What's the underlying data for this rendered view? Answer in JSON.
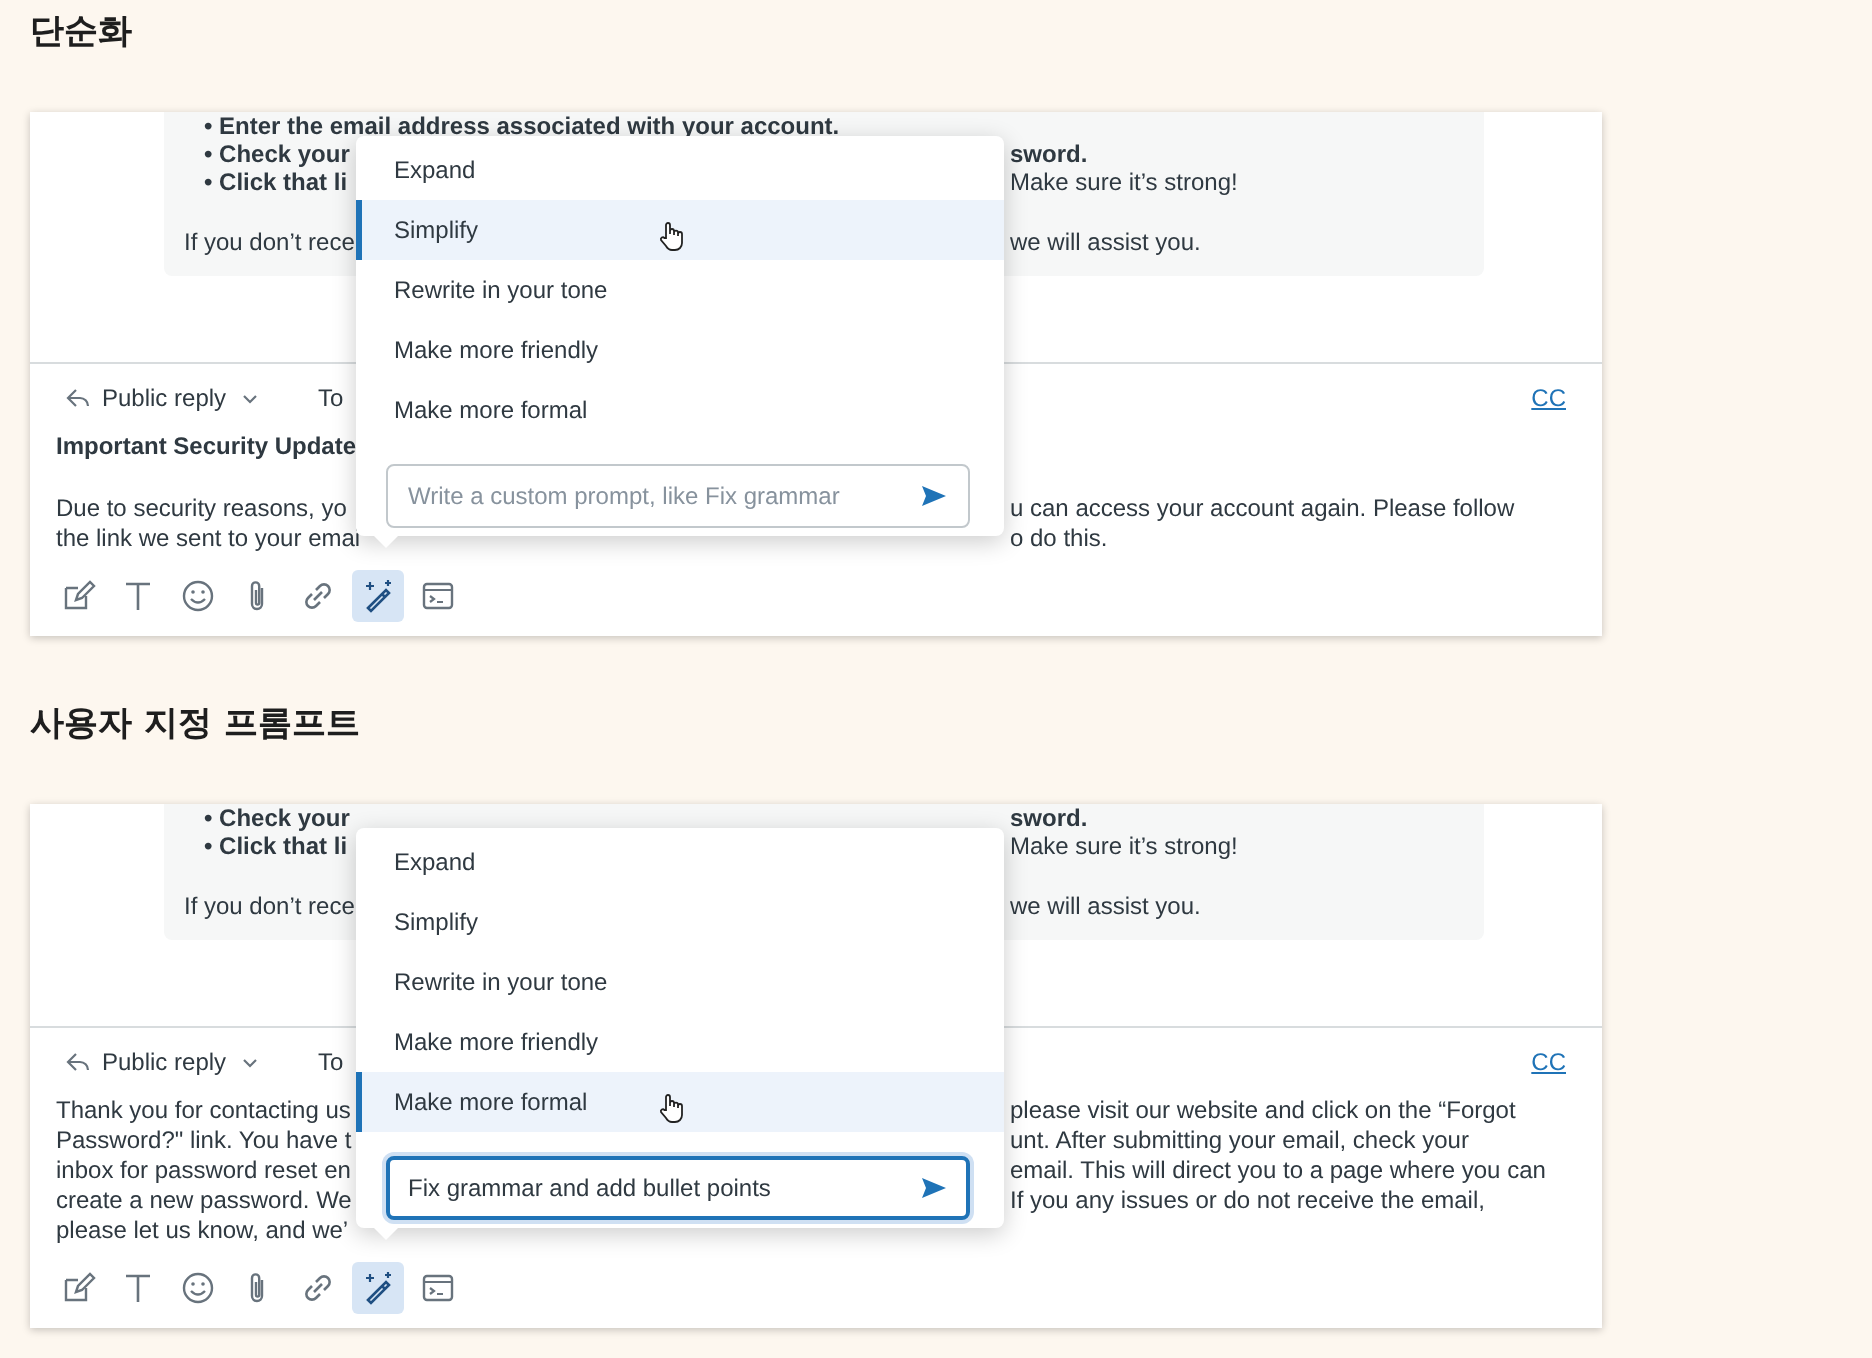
{
  "sections": [
    {
      "heading": "단순화",
      "quote_lines": [
        {
          "kind": "bullet",
          "left": {
            "text": "• Enter the email address associated with your account.",
            "bold": true
          }
        },
        {
          "kind": "bullet",
          "left": {
            "text": "• Check your",
            "bold": true
          },
          "right": {
            "text": "sword.",
            "bold": true
          }
        },
        {
          "kind": "bullet",
          "left": {
            "text": "• Click that li",
            "bold": true
          },
          "right": {
            "text": "Make sure it’s strong!",
            "bold": false
          }
        },
        {
          "kind": "paragraph",
          "left": {
            "text": "If you don’t rece",
            "bold": false
          },
          "right": {
            "text": "we will assist you.",
            "bold": false
          }
        }
      ],
      "reply": {
        "mode": "Public reply",
        "to_label": "To",
        "cc": "CC"
      },
      "body_lines": [
        {
          "kind": "subject",
          "left": {
            "text": "Important Security Update",
            "bold": true
          }
        },
        {
          "kind": "paragraph",
          "left": {
            "text": "Due to security reasons, yo",
            "bold": false
          },
          "right": {
            "text": "u can access your account again. Please follow",
            "bold": false
          }
        },
        {
          "kind": "text",
          "left": {
            "text": "the link we sent to your emai",
            "bold": false
          },
          "right": {
            "text": "o do this.",
            "bold": false
          }
        }
      ],
      "tools": [
        {
          "kind": "compose",
          "selected": false
        },
        {
          "kind": "text",
          "selected": false
        },
        {
          "kind": "emoji",
          "selected": false
        },
        {
          "kind": "attach",
          "selected": false
        },
        {
          "kind": "link",
          "selected": false
        },
        {
          "kind": "ai",
          "selected": true
        },
        {
          "kind": "terminal",
          "selected": false
        }
      ],
      "menu": {
        "items": [
          {
            "label": "Expand",
            "selected": false
          },
          {
            "label": "Simplify",
            "selected": true
          },
          {
            "label": "Rewrite in your tone",
            "selected": false
          },
          {
            "label": "Make more friendly",
            "selected": false
          },
          {
            "label": "Make more formal",
            "selected": false
          }
        ],
        "prompt": {
          "placeholder": "Write a custom prompt, like Fix grammar",
          "focused": false
        }
      }
    },
    {
      "heading": "사용자 지정 프롬프트",
      "quote_lines": [
        {
          "kind": "bullet",
          "left": {
            "text": "• Check your",
            "bold": true
          },
          "right": {
            "text": "sword.",
            "bold": true
          }
        },
        {
          "kind": "bullet",
          "left": {
            "text": "• Click that li",
            "bold": true
          },
          "right": {
            "text": "Make sure it’s strong!",
            "bold": false
          }
        },
        {
          "kind": "paragraph",
          "left": {
            "text": "If you don’t rece",
            "bold": false
          },
          "right": {
            "text": "we will assist you.",
            "bold": false
          }
        }
      ],
      "reply": {
        "mode": "Public reply",
        "to_label": "To",
        "cc": "CC"
      },
      "body_lines": [
        {
          "kind": "text",
          "left": {
            "text": "Thank you for contacting us",
            "bold": false
          },
          "right": {
            "text": "please visit our website and click on the “Forgot",
            "bold": false
          }
        },
        {
          "kind": "text",
          "left": {
            "text": "Password?\" link. You have t",
            "bold": false
          },
          "right": {
            "text": "unt. After submitting your email, check your",
            "bold": false
          }
        },
        {
          "kind": "text",
          "left": {
            "text": "inbox for password reset en",
            "bold": false
          },
          "right": {
            "text": "email. This will direct you to a page where you can",
            "bold": false
          }
        },
        {
          "kind": "text",
          "left": {
            "text": "create a new password. We",
            "bold": false
          },
          "right": {
            "text": "If you any issues or do not receive the email,",
            "bold": false
          }
        },
        {
          "kind": "text",
          "left": {
            "text": "please let us know, and we’",
            "bold": false
          }
        }
      ],
      "tools": [
        {
          "kind": "compose",
          "selected": false
        },
        {
          "kind": "text",
          "selected": false
        },
        {
          "kind": "emoji",
          "selected": false
        },
        {
          "kind": "attach",
          "selected": false
        },
        {
          "kind": "link",
          "selected": false
        },
        {
          "kind": "ai",
          "selected": true
        },
        {
          "kind": "terminal",
          "selected": false
        }
      ],
      "menu": {
        "items": [
          {
            "label": "Expand",
            "selected": false
          },
          {
            "label": "Simplify",
            "selected": false
          },
          {
            "label": "Rewrite in your tone",
            "selected": false
          },
          {
            "label": "Make more friendly",
            "selected": false
          },
          {
            "label": "Make more formal",
            "selected": true
          }
        ],
        "prompt": {
          "value": "Fix grammar and add bullet points",
          "focused": true
        }
      }
    }
  ]
}
